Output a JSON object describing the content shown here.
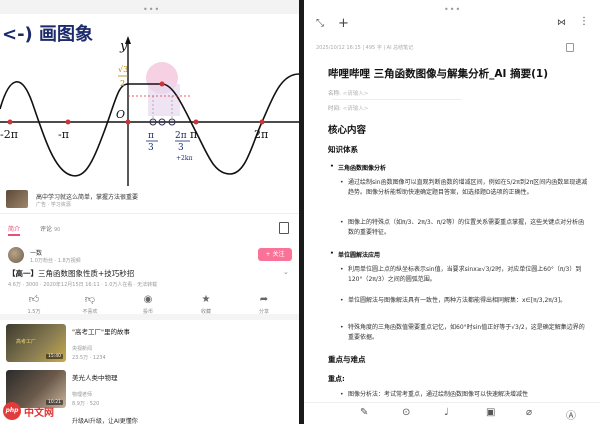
{
  "video_app": {
    "video": {
      "title_overlay": "<-) 画图象",
      "y_axis": "y",
      "labels": {
        "neg2pi": "-2π",
        "negpi": "-π",
        "origin": "O",
        "sqrt3_over_2_num": "√3",
        "sqrt3_over_2_den": "2",
        "pi": "π",
        "two_pi": "2π",
        "x_num1": "π",
        "x_den1": "3",
        "x_num2": "2π",
        "x_den2": "3",
        "x_suffix": "+2kπ"
      }
    },
    "recommend_bar": {
      "title": "高中学习就这么简单，掌握方法很重要",
      "meta": "广告 · 学习资源"
    },
    "tabs": {
      "intro": "简介",
      "comments": "评论",
      "comments_count": "90"
    },
    "uploader": {
      "name": "一数",
      "fans": "1.0万粉丝 · 1.8万视频",
      "follow": "+ 关注"
    },
    "video_title": {
      "tag": "【高一】",
      "rest": "三角函数图象性质+技巧秒招"
    },
    "video_stats": "4.6万 · 3000 · 2020年12月15日 16:11 · 1.0万人在看 · 无法转载",
    "actions": [
      {
        "icon": "thumb-up-icon",
        "label": "1.5万"
      },
      {
        "icon": "thumb-down-icon",
        "label": "不喜欢"
      },
      {
        "icon": "coin-icon",
        "label": "投币"
      },
      {
        "icon": "star-icon",
        "label": "收藏"
      },
      {
        "icon": "share-icon",
        "label": "分享"
      }
    ],
    "recommendations": [
      {
        "title": "\"高考工厂\"里的故事",
        "badge": "高考工厂",
        "uploader": "央视新闻",
        "stats": "23.5万 · 1234",
        "duration": "15:40"
      },
      {
        "title": "美光人类中物理",
        "badge": "",
        "uploader": "物理老师",
        "stats": "8.9万 · 520",
        "duration": "10:21"
      }
    ],
    "ai_promo": "升级AI升级，让AI更懂你"
  },
  "watermark": {
    "circle": "php",
    "text": "中文网"
  },
  "notes_app": {
    "meta": "2025/10/12 16:15 | 495 字 | AI 总结笔记",
    "title": "哔哩哔哩 三角函数图像与解集分析_AI 摘要(1)",
    "props": [
      {
        "label": "名称:",
        "placeholder": "<请输入>"
      },
      {
        "label": "时间:",
        "placeholder": "<请输入>"
      }
    ],
    "h2_core": "核心内容",
    "h3_system": "知识体系",
    "h4_graph": "三角函数图像分析",
    "p_graph1": "通过绘制sin函数图像可以直观判断函数的增减区间，例如在5/2π到2π区间内函数显现递减趋势。图像分析能帮助快速确定题目答案，如选择题D选项的正确性。",
    "p_graph2": "图像上的特殊点（如π/3、2π/3、π/2等）的位置关系需要重点掌握，这些关键点对分析函数的重要特征。",
    "h4_circle": "单位圆解法应用",
    "p_circle1": "利用单位圆上点的纵坐标表示sin值，当要求sinx≥√3/2时，对应单位圆上60°（π/3）到120°（2π/3）之间的圆弧范围。",
    "p_circle2": "单位圆解法与图像解法具有一致性，两种方法都能得出相同解集：x∈[π/3,2π/3]。",
    "p_circle3": "特殊角度的三角函数值需要重点记忆，如60°时sin值正好等于√3/2，这是确定解集边界的重要依据。",
    "h3_key": "重点与难点",
    "h4_key": "重点:",
    "p_key1": "图像分析法：考试常考重点，通过绘制函数图像可以快速解决增减性"
  }
}
